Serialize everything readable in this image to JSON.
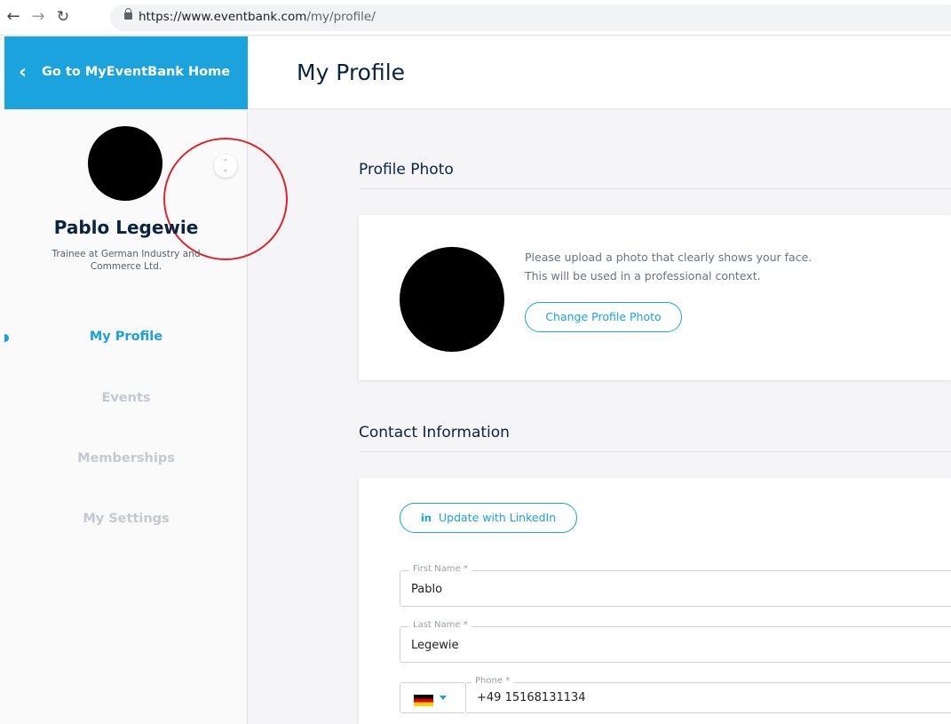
{
  "browser": {
    "url_host": "https://www.eventbank.com",
    "url_path": "/my/profile/"
  },
  "sidebar": {
    "home_label": "Go to MyEventBank Home",
    "user_name": "Pablo Legewie",
    "user_title": "Trainee at German Industry and Commerce Ltd.",
    "items": [
      {
        "label": "My Profile",
        "active": true
      },
      {
        "label": "Events",
        "active": false
      },
      {
        "label": "Memberships",
        "active": false
      },
      {
        "label": "My Settings",
        "active": false
      }
    ]
  },
  "main": {
    "page_title": "My Profile",
    "profile_photo": {
      "section_title": "Profile Photo",
      "hint_line1": "Please upload a photo that clearly shows your face.",
      "hint_line2": "This will be used in a professional context.",
      "change_button": "Change Profile Photo"
    },
    "contact": {
      "section_title": "Contact Information",
      "linkedin_icon": "in",
      "linkedin_button": "Update with LinkedIn",
      "first_name_label": "First Name *",
      "first_name_value": "Pablo",
      "last_name_label": "Last Name *",
      "last_name_value": "Legewie",
      "phone_label": "Phone *",
      "phone_value": "+49 15168131134"
    }
  },
  "colors": {
    "accent": "#1aa3dd",
    "title": "#0a2340",
    "annotation": "#e0232a"
  }
}
